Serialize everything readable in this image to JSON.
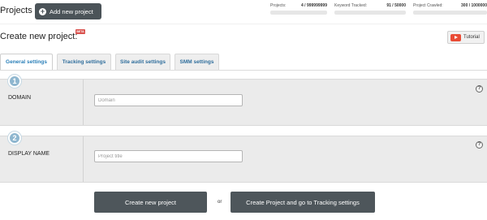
{
  "header": {
    "title": "Projects",
    "add_button_label": "Add new project",
    "stats": [
      {
        "label": "Projects:",
        "value": "4 / 999999999",
        "fraction": 0.0
      },
      {
        "label": "Keyword Tracked:",
        "value": "91 / 50000",
        "fraction": 0.0
      },
      {
        "label": "Project Crawled:",
        "value": "300 / 1000000",
        "fraction": 0.0
      }
    ]
  },
  "page": {
    "title": "Create new project:",
    "beta_badge": "BETA",
    "tutorial_label": "Tutorial"
  },
  "tabs": [
    {
      "label": "General settings",
      "active": true
    },
    {
      "label": "Tracking settings",
      "active": false
    },
    {
      "label": "Site audit settings",
      "active": false
    },
    {
      "label": "SMM settings",
      "active": false
    }
  ],
  "form": {
    "domain": {
      "step": "1",
      "label": "DOMAIN",
      "placeholder": "Domain",
      "value": "",
      "help": "?"
    },
    "display_name": {
      "step": "2",
      "label": "DISPLAY NAME",
      "placeholder": "Project title",
      "value": "",
      "help": "?"
    }
  },
  "actions": {
    "create_label": "Create new project",
    "or_label": "or",
    "create_tracking_label": "Create Project and go to Tracking settings"
  },
  "colors": {
    "dark_button": "#4e565b",
    "accent_blue": "#2a7fb8",
    "step_badge": "#8eb6cf",
    "section_bg": "#ebebeb",
    "youtube_red": "#e94b35"
  }
}
